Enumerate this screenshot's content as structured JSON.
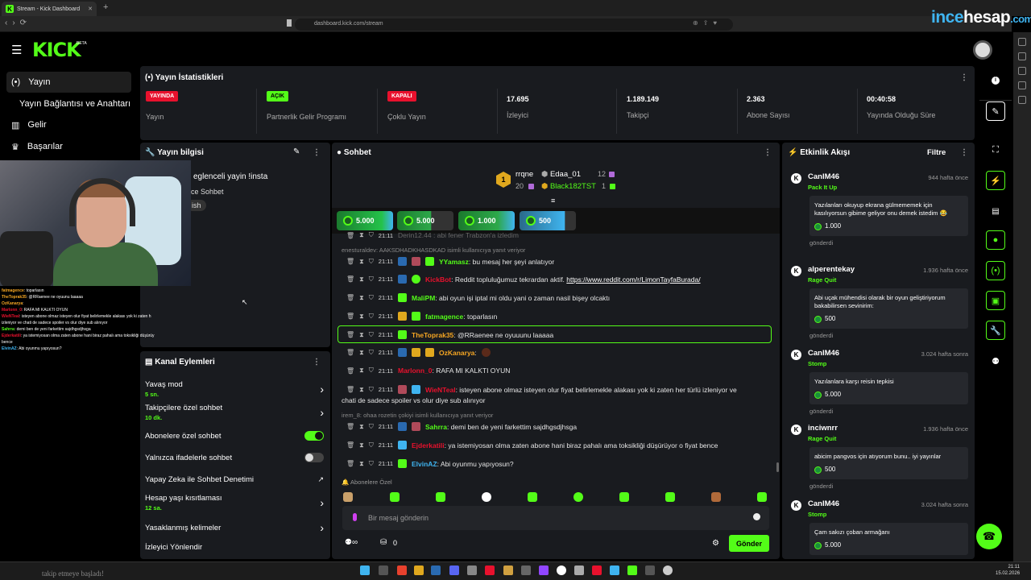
{
  "browser": {
    "tab_title": "Stream - Kick Dashboard",
    "url": "dashboard.kick.com/stream",
    "watermark_a": "ince",
    "watermark_b": "hesap",
    "watermark_c": ".com"
  },
  "header": {
    "logo": "KICK",
    "beta": "BETA"
  },
  "nav": {
    "items": [
      {
        "icon": "(•)",
        "label": "Yayın"
      },
      {
        "icon": "",
        "label": "Yayın Bağlantısı ve Anahtarı"
      },
      {
        "icon": "▥",
        "label": "Gelir"
      },
      {
        "icon": "♛",
        "label": "Başarılar"
      }
    ]
  },
  "stats": {
    "title": "Yayın İstatistikleri",
    "items": [
      {
        "badge": "YAYINDA",
        "label": "Yayın"
      },
      {
        "badge": "AÇIK",
        "label": "Partnerlik Gelir Programı"
      },
      {
        "badge": "KAPALI",
        "label": "Çoklu Yayın"
      },
      {
        "value": "17.695",
        "label": "İzleyici"
      },
      {
        "value": "1.189.149",
        "label": "Takipçi"
      },
      {
        "value": "2.363",
        "label": "Abone Sayısı"
      },
      {
        "value": "00:40:58",
        "label": "Yayında Olduğu Süre"
      }
    ]
  },
  "yayin_bilgisi": {
    "title": "Yayın bilgisi",
    "line1": "eglenceli yayin !insta",
    "line2": "ce Sohbet",
    "tag": "ish"
  },
  "overlay_chat": [
    {
      "user": "fatmagence",
      "text": ": toparlasın"
    },
    {
      "user": "TheToprak35",
      "text": ": @RRaenee ne oyuunu laaaaa"
    },
    {
      "user": "OzKanarya",
      "text": ":"
    },
    {
      "user": "Marlonn_0",
      "text": ": RAFA MI KALKTI OYUN"
    },
    {
      "user": "WieNTeal",
      "text": ": isteyen abone olmaz isteyen olur fiyat belirlemekle alakası yok ki zaten h"
    },
    {
      "user": "",
      "text": "izleniyor ve chati de sadece spoiler vs olur diye sub alınıyor"
    },
    {
      "user": "Sahrra",
      "text": ": demi ben de yeni farkettim sajdhgsdjhsga"
    },
    {
      "user": "Ejderkatili",
      "text": ": ya istemiyosan olma zaten abone hani biraz pahalı ama toksikliği düşürüy"
    },
    {
      "user": "",
      "text": "bence"
    },
    {
      "user": "ElvinAZ",
      "text": ": Abi oyunmu yapıyosun?"
    }
  ],
  "kanal": {
    "title": "Kanal Eylemleri",
    "rows": [
      {
        "label": "Yavaş mod",
        "sub": "5 sn."
      },
      {
        "label": "Takipçilere özel sohbet",
        "sub": "10 dk."
      },
      {
        "label": "Abonelere özel sohbet",
        "sub": ""
      },
      {
        "label": "Yalnızca ifadelerle sohbet",
        "sub": ""
      },
      {
        "label": "Yapay Zeka ile Sohbet Denetimi",
        "sub": ""
      },
      {
        "label": "Hesap yaşı kısıtlaması",
        "sub": "12 sa."
      },
      {
        "label": "Yasaklanmış kelimeler",
        "sub": ""
      },
      {
        "label": "İzleyici Yönlendir",
        "sub": ""
      }
    ]
  },
  "chat": {
    "title": "Sohbet",
    "leaders": [
      {
        "rank": "1",
        "name": "rrqne",
        "count": "20"
      },
      {
        "name": "Edaa_01",
        "count": "12"
      },
      {
        "name": "Black182TST",
        "count": "1"
      }
    ],
    "gifts": [
      "5.000",
      "5.000",
      "1.000",
      "500"
    ],
    "cut_top": "Derin12.44 : abi fener Trabzon'a izledim",
    "messages": [
      {
        "reply": "enesturaldev: AAKSDHADKHASDKAD isimli kullanıcıya yanıt veriyor"
      },
      {
        "time": "21:11",
        "user": "YYamasz",
        "color": "#53fc18",
        "text": ": bu mesaj her şeyi anlatıyor"
      },
      {
        "time": "21:11",
        "user": "KickBot",
        "color": "#e8112d",
        "text": ": Reddit topluluğumuz tekrardan aktif. ",
        "link": "https://www.reddit.com/r/LimonTayfaBurada/"
      },
      {
        "time": "21:11",
        "user": "MaliPM",
        "color": "#53fc18",
        "text": ": abi oyun işi iptal mi oldu yani o zaman nasil bişey olcaktı"
      },
      {
        "time": "21:11",
        "user": "fatmagence",
        "color": "#53fc18",
        "text": ": toparlasın"
      },
      {
        "time": "21:11",
        "user": "TheToprak35",
        "color": "#f5a623",
        "text": ": @RRaenee ne oyuuunu laaaaa"
      },
      {
        "time": "21:11",
        "user": "OzKanarya",
        "color": "#f5a623",
        "text": ":"
      },
      {
        "time": "21:11",
        "user": "Marlonn_0",
        "color": "#e8112d",
        "text": ": RAFA MI KALKTI OYUN"
      },
      {
        "time": "21:11",
        "user": "WieNTeal",
        "color": "#e8112d",
        "text": ": isteyen abone olmaz isteyen olur fiyat belirlemekle alakası yok ki zaten her türlü izleniyor ve"
      },
      {
        "cont": "chati de sadece spoiler vs olur diye sub alınıyor"
      },
      {
        "reply": "irem_8: ohaa rozetin çokiyi isimli kullanıcıya yanıt veriyor"
      },
      {
        "time": "21:11",
        "user": "Sahrra",
        "color": "#53fc18",
        "text": ": demi ben de yeni farkettim sajdhgsdjhsga"
      },
      {
        "time": "21:11",
        "user": "Ejderkatili",
        "color": "#e8112d",
        "text": ": ya istemiyosan olma zaten abone hani biraz pahalı ama toksikliği düşürüyor o fiyat bence"
      },
      {
        "time": "21:11",
        "user": "ElvinAZ",
        "color": "#3fb4f0",
        "text": ": Abi oyunmu yapıyosun?"
      }
    ],
    "emote_label": "Abonelere Özel",
    "input_placeholder": "Bir mesaj gönderin",
    "counter": "0",
    "send": "Gönder"
  },
  "events": {
    "title": "Etkinlik Akışı",
    "filter": "Filtre",
    "items": [
      {
        "user": "CanIM46",
        "time": "944 hafta önce",
        "type": "Pack It Up",
        "msg": "Yazılanları okuyup ekrana gülmememek için kasılıyorsun gibime geliyor onu demek istedim 😂",
        "amount": "1.000",
        "sent": "gönderdi"
      },
      {
        "user": "alperentekay",
        "time": "1.936 hafta önce",
        "type": "Rage Quit",
        "msg": "Abi uçak mühendisi olarak bir oyun geliştiriyorum bakabilirsen sevinirim:",
        "amount": "500",
        "sent": "gönderdi"
      },
      {
        "user": "CanIM46",
        "time": "3.024 hafta sonra",
        "type": "Stomp",
        "msg": "Yazılanlara karşı reisin tepkisi",
        "amount": "5.000",
        "sent": "gönderdi"
      },
      {
        "user": "inciwnrr",
        "time": "1.936 hafta önce",
        "type": "Rage Quit",
        "msg": "abicim pangvos için atıyorum bunu.. iyi yayınlar",
        "amount": "500",
        "sent": "gönderdi"
      },
      {
        "user": "CanIM46",
        "time": "3.024 hafta sonra",
        "type": "Stomp",
        "msg": "Çam sakızı çoban armağanı",
        "amount": "5.000",
        "sent": ""
      }
    ]
  },
  "taskbar": {
    "message": "takip etmeye başladı!",
    "time": "21:11",
    "date": "15.02.2026"
  }
}
